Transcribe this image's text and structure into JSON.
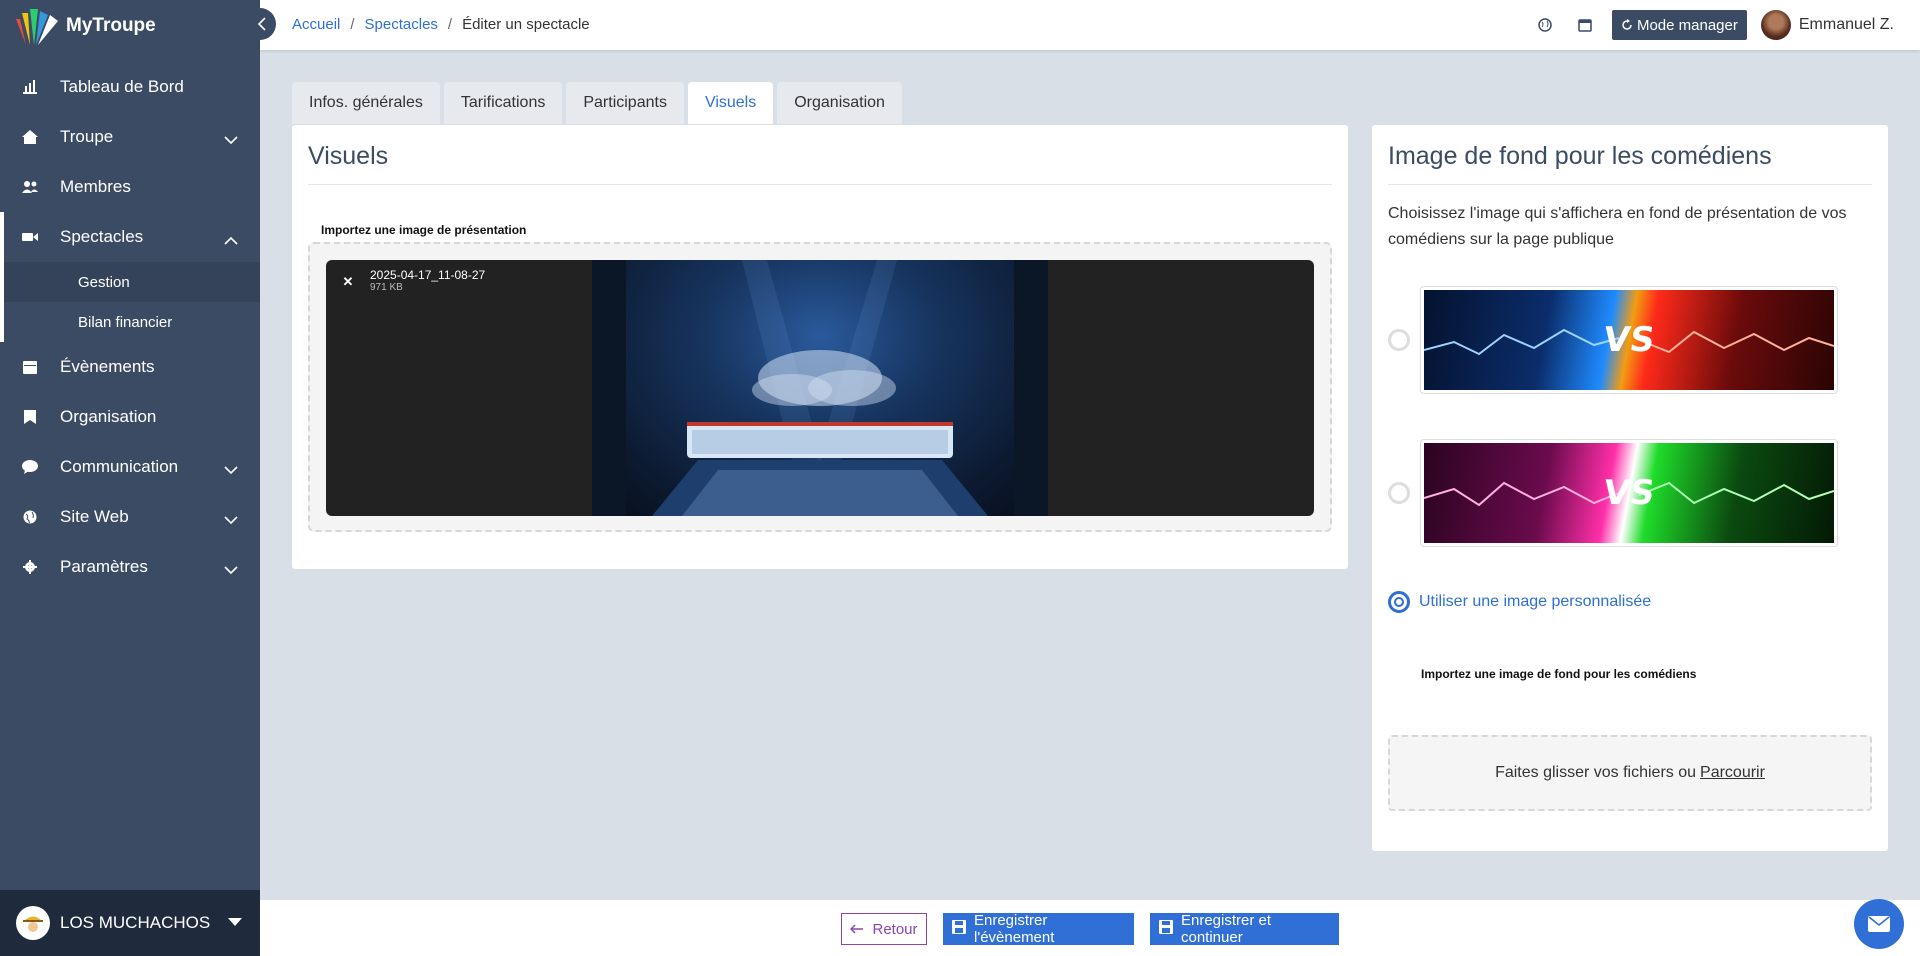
{
  "app": {
    "name": "MyTroupe"
  },
  "sidebar": {
    "items": [
      {
        "label": "Tableau de Bord",
        "icon": "chart-icon"
      },
      {
        "label": "Troupe",
        "icon": "home-icon",
        "expandable": true
      },
      {
        "label": "Membres",
        "icon": "users-icon"
      },
      {
        "label": "Spectacles",
        "icon": "video-icon",
        "expanded": true
      },
      {
        "label": "Évènements",
        "icon": "calendar-icon"
      },
      {
        "label": "Organisation",
        "icon": "bookmark-icon"
      },
      {
        "label": "Communication",
        "icon": "chat-icon",
        "expandable": true
      },
      {
        "label": "Site Web",
        "icon": "globe-icon",
        "expandable": true
      },
      {
        "label": "Paramètres",
        "icon": "gear-icon",
        "expandable": true
      }
    ],
    "subitems": [
      {
        "label": "Gestion",
        "active": true
      },
      {
        "label": "Bilan financier"
      }
    ],
    "org_name": "LOS MUCHACHOS"
  },
  "breadcrumb": {
    "home": "Accueil",
    "section": "Spectacles",
    "current": "Éditer un spectacle"
  },
  "header": {
    "mode_button": "Mode manager",
    "user_name": "Emmanuel Z."
  },
  "tabs": [
    {
      "label": "Infos. générales"
    },
    {
      "label": "Tarifications"
    },
    {
      "label": "Participants"
    },
    {
      "label": "Visuels",
      "active": true
    },
    {
      "label": "Organisation"
    }
  ],
  "visuals": {
    "title": "Visuels",
    "upload_label": "Importez une image de présentation",
    "file_name": "2025-04-17_11-08-27",
    "file_size": "971 KB"
  },
  "background": {
    "title": "Image de fond pour les comédiens",
    "description": "Choisissez l'image qui s'affichera en fond de présentation de vos comédiens sur la page publique",
    "options": [
      {
        "text": "VS",
        "left_color": "#1f8bff",
        "right_color": "#ff2a1a",
        "selected": false
      },
      {
        "text": "VS",
        "left_color": "#ff2fa8",
        "right_color": "#1fdc2a",
        "selected": false
      }
    ],
    "custom_label": "Utiliser une image personnalisée",
    "upload_label": "Importez une image de fond pour les comédiens",
    "drop_text": "Faites glisser vos fichiers ou",
    "browse": "Parcourir"
  },
  "footer": {
    "back": "Retour",
    "save": "Enregistrer l'évènement",
    "save_continue": "Enregistrer et continuer"
  },
  "colors": {
    "sidebar": "#3c4b64",
    "accent": "#2f6fd6",
    "back": "#8e44ad"
  }
}
